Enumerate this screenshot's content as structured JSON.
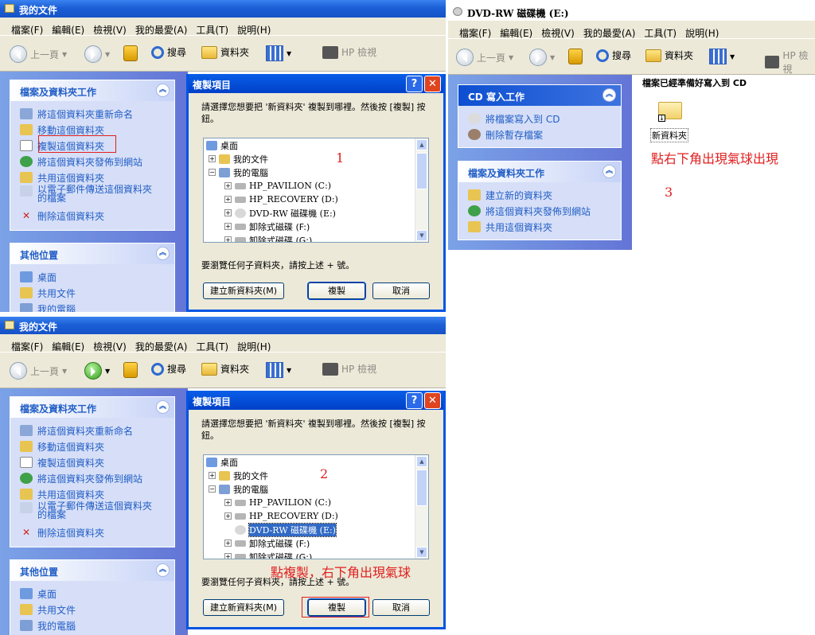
{
  "explorer": {
    "title": "我的文件",
    "menu": [
      "檔案(F)",
      "編輯(E)",
      "檢視(V)",
      "我的最愛(A)",
      "工具(T)",
      "說明(H)"
    ],
    "toolbar": {
      "back": "上一頁",
      "search": "搜尋",
      "folders": "資料夾",
      "hp_view": "HP 檢視"
    },
    "tasks": {
      "header": "檔案及資料夾工作",
      "items": [
        "將這個資料夾重新命名",
        "移動這個資料夾",
        "複製這個資料夾",
        "將這個資料夾發佈到網站",
        "共用這個資料夾",
        "以電子郵件傳送這個資料夾的檔案",
        "刪除這個資料夾"
      ]
    },
    "places": {
      "header": "其他位置",
      "items": [
        "桌面",
        "共用文件",
        "我的電腦"
      ]
    }
  },
  "dialog": {
    "title": "複製項目",
    "instruction": "請選擇您想要把 '新資料夾' 複製到哪裡。然後按 [複製] 按鈕。",
    "tree": [
      "桌面",
      "我的文件",
      "我的電腦",
      "HP_PAVILION (C:)",
      "HP_RECOVERY (D:)",
      "DVD-RW 磁碟機 (E:)",
      "卸除式磁碟 (F:)",
      "卸除式磁碟 (G:)"
    ],
    "hint": "要瀏覽任何子資料夾，請按上述 + 號。",
    "new_folder": "建立新資料夾(M)",
    "copy": "複製",
    "cancel": "取消"
  },
  "dvd": {
    "title": "DVD-RW 磁碟機 (E:)",
    "cd_tasks": {
      "header": "CD 寫入工作",
      "items": [
        "將檔案寫入到 CD",
        "刪除暫存檔案"
      ]
    },
    "file_tasks": {
      "header": "檔案及資料夾工作",
      "items": [
        "建立新的資料夾",
        "將這個資料夾發佈到網站",
        "共用這個資料夾"
      ]
    },
    "ready_text": "檔案已經準備好寫入到 CD",
    "folder_label": "新資料夾"
  },
  "annotations": {
    "step1": "1",
    "step2": "2",
    "step3": "3",
    "note_copy": "點複製，右下角出現氣球",
    "note_balloon": "點右下角出現氣球出現"
  },
  "colors": {
    "title_blue": "#1b5fd6",
    "task_blue": "#215dc6",
    "annotation_red": "#e02020"
  }
}
